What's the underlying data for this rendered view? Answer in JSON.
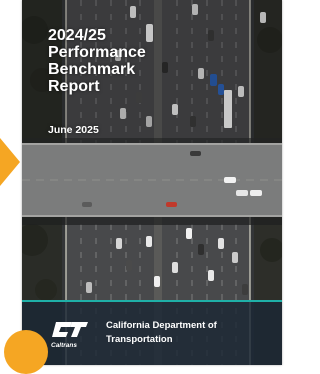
{
  "cover": {
    "title_lines": [
      "2024/25",
      "Performance",
      "Benchmark",
      "Report"
    ],
    "date": "June 2025"
  },
  "footer": {
    "logo_text": "Caltrans",
    "department_lines": [
      "California Department of",
      "Transportation"
    ]
  },
  "colors": {
    "accent_orange": "#f5a623",
    "footer_band": "#1b2734",
    "footer_rule": "#1fb0a8"
  }
}
